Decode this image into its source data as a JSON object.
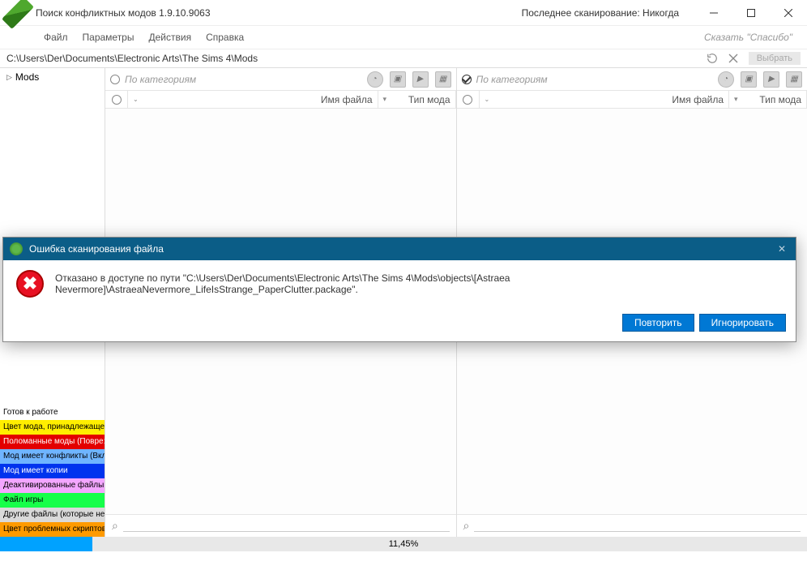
{
  "window": {
    "title": "Поиск конфликтных модов 1.9.10.9063",
    "last_scan_label": "Последнее сканирование: Никогда"
  },
  "menu": {
    "file": "Файл",
    "params": "Параметры",
    "actions": "Действия",
    "help": "Справка",
    "thanks": "Сказать \"Спасибо\""
  },
  "path": {
    "value": "C:\\Users\\Der\\Documents\\Electronic Arts\\The Sims 4\\Mods",
    "select_btn": "Выбрать"
  },
  "tree": {
    "root": "Mods"
  },
  "legend": [
    {
      "label": "Готов к работе",
      "bg": "#ffffff",
      "fg": "#000000"
    },
    {
      "label": "Цвет мода, принадлежащег",
      "bg": "#ffee00",
      "fg": "#000000"
    },
    {
      "label": "Поломанные моды (Повре:",
      "bg": "#e30000",
      "fg": "#ffffff"
    },
    {
      "label": "Мод имеет конфликты (Вкл",
      "bg": "#6fb4ff",
      "fg": "#000000"
    },
    {
      "label": "Мод имеет копии",
      "bg": "#0033ee",
      "fg": "#ffffff"
    },
    {
      "label": "Деактивированные файлы",
      "bg": "#f3a6ff",
      "fg": "#000000"
    },
    {
      "label": "Файл игры",
      "bg": "#16ff4a",
      "fg": "#000000"
    },
    {
      "label": "Другие файлы (которые не",
      "bg": "#d9d9d9",
      "fg": "#000000"
    },
    {
      "label": "Цвет проблемных скриптов",
      "bg": "#ff9a00",
      "fg": "#000000"
    }
  ],
  "columns": {
    "filename": "Имя файла",
    "modtype": "Тип мода"
  },
  "panes": {
    "left": {
      "category_placeholder": "По категориям"
    },
    "right": {
      "category_placeholder": "По категориям"
    }
  },
  "progress": {
    "percent": 11.45,
    "label": "11,45%"
  },
  "dialog": {
    "title": "Ошибка сканирования файла",
    "message": "Отказано в доступе по пути \"C:\\Users\\Der\\Documents\\Electronic Arts\\The Sims 4\\Mods\\objects\\[Astraea Nevermore]\\AstraeaNevermore_LifeIsStrange_PaperClutter.package\".",
    "retry": "Повторить",
    "ignore": "Игнорировать"
  }
}
